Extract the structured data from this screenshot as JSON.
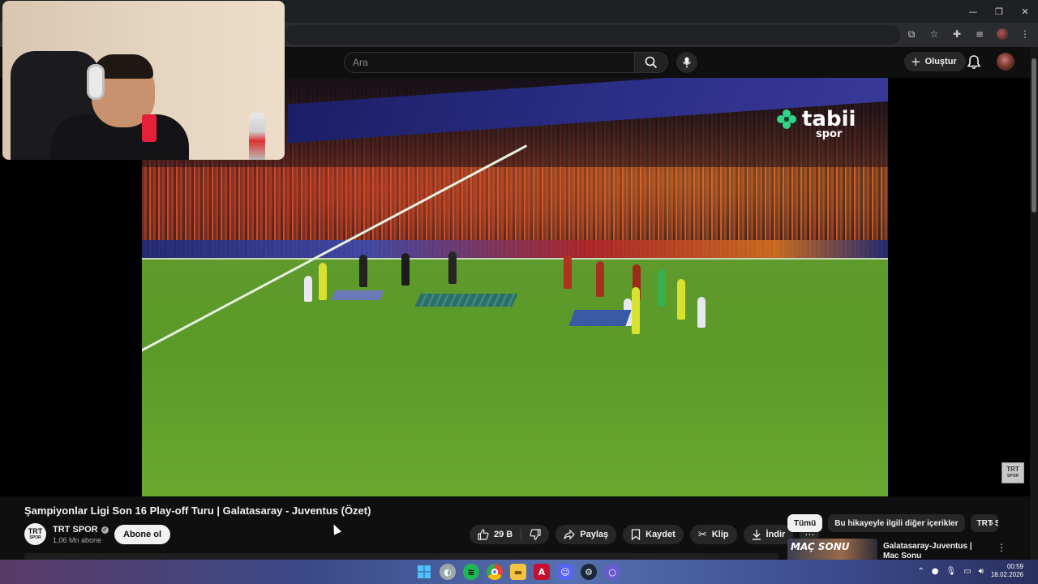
{
  "browser": {
    "window_controls": [
      "minimize",
      "restore",
      "close"
    ]
  },
  "masthead": {
    "search_placeholder": "Ara",
    "create_label": "Oluştur"
  },
  "player": {
    "overlay_logo": "tabii",
    "overlay_logo_sub": "spor",
    "watermark_top": "TRT",
    "watermark_bottom": "SPOR"
  },
  "video": {
    "title": "Şampiyonlar Ligi Son 16 Play-off Turu | Galatasaray - Juventus (Özet)",
    "channel_avatar_text": "TRT",
    "channel_avatar_sub": "SPOR",
    "channel_name": "TRT SPOR",
    "subscribers": "1,06 Mn abone",
    "subscribe_label": "Abone ol",
    "like_count": "29 B",
    "share_label": "Paylaş",
    "save_label": "Kaydet",
    "clip_label": "Klip",
    "download_label": "İndir"
  },
  "sidebar": {
    "chips": [
      "Tümü",
      "Bu hikayeyle ilgili diğer içerikler",
      "TRT S"
    ],
    "recommendation": {
      "thumb_text": "MAÇ SONU",
      "title": "Galatasaray-Juventus | Maç Sonu Değerlendirmesi"
    }
  },
  "taskbar": {
    "icons": [
      "windows-start",
      "search",
      "spotify",
      "chrome",
      "file-explorer",
      "app-a",
      "discord",
      "steam",
      "app-circle"
    ],
    "time": "00:59",
    "date": "18.02.2026"
  },
  "colors": {
    "background": "#0f0f0f",
    "chip_active": "#f1f1f1",
    "pill": "#272727",
    "tabii_green": "#2fd68a"
  }
}
